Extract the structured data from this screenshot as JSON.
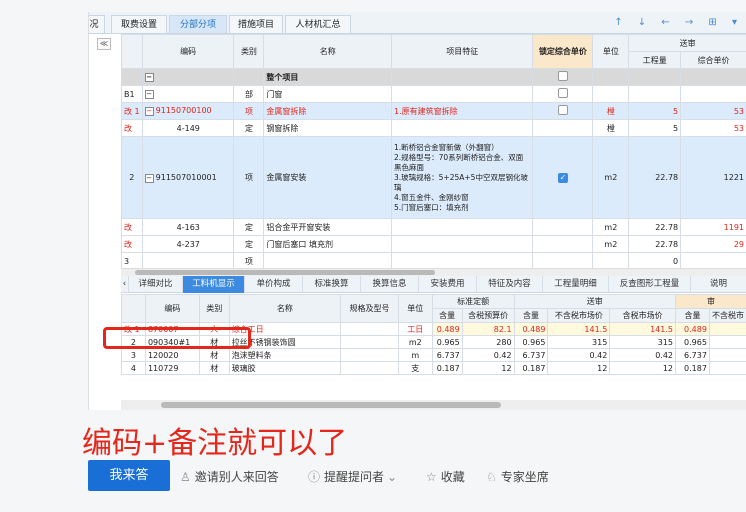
{
  "top_tabs": [
    {
      "label": "况"
    },
    {
      "label": "取费设置"
    },
    {
      "label": "分部分项"
    },
    {
      "label": "措施项目"
    },
    {
      "label": "人材机汇总"
    }
  ],
  "top_icons": "↑ ↓ ← → ⊞ ▾",
  "collapse_icon": "≪",
  "main_table": {
    "headers": {
      "code": "编码",
      "type": "类别",
      "name": "名称",
      "features": "项目特征",
      "lock": "锁定综合单价",
      "unit": "单位",
      "qty": "工程量",
      "price_group": "送审",
      "price": "综合单价"
    },
    "rows": [
      {
        "idx": "",
        "code": "",
        "type": "",
        "name": "整个项目",
        "features": "",
        "unit": "",
        "qty": "",
        "price": ""
      },
      {
        "idx": "B1",
        "code": "",
        "type": "部",
        "name": "门窗",
        "features": "",
        "unit": "",
        "qty": "",
        "price": ""
      },
      {
        "idx": "改 1",
        "code": "91150700100",
        "type": "项",
        "name": "金属窗拆除",
        "features": "1.原有建筑窗拆除",
        "unit": "樘",
        "qty": "5",
        "price": "53"
      },
      {
        "idx": "改",
        "code": "4-149",
        "type": "定",
        "name": "钢窗拆除",
        "features": "",
        "unit": "樘",
        "qty": "5",
        "price": "53"
      },
      {
        "idx": "2",
        "code": "911507010001",
        "type": "项",
        "name": "金属窗安装",
        "features": "1.断桥铝合金窗新做（外翻窗）\n2.规格型号：70系列断桥铝合金、双面黑色麻面\n3.玻璃规格：5+25A+5中空双层钢化玻璃\n4.窗五金件、金刚纱窗\n5.门窗后塞口：填充剂",
        "unit": "m2",
        "qty": "22.78",
        "price": "1221"
      },
      {
        "idx": "改",
        "code": "4-163",
        "type": "定",
        "name": "铝合金平开窗安装",
        "features": "",
        "unit": "m2",
        "qty": "22.78",
        "price": "1191"
      },
      {
        "idx": "改",
        "code": "4-237",
        "type": "定",
        "name": "门窗后塞口 填充剂",
        "features": "",
        "unit": "m2",
        "qty": "22.78",
        "price": "29"
      },
      {
        "idx": "3",
        "code": "",
        "type": "项",
        "name": "",
        "features": "",
        "unit": "",
        "qty": "0",
        "price": ""
      }
    ]
  },
  "sub_tabs": [
    {
      "label": "详细对比"
    },
    {
      "label": "工料机显示"
    },
    {
      "label": "单价构成"
    },
    {
      "label": "标准换算"
    },
    {
      "label": "换算信息"
    },
    {
      "label": "安装费用"
    },
    {
      "label": "特征及内容"
    },
    {
      "label": "工程量明细"
    },
    {
      "label": "反查图形工程量"
    },
    {
      "label": "说明"
    }
  ],
  "material_table": {
    "headers": {
      "code": "编码",
      "type": "类别",
      "name": "名称",
      "spec": "规格及型号",
      "unit": "单位",
      "std_group": "标准定额",
      "std_qty": "含量",
      "std_price": "含税预算价",
      "review_group": "送审",
      "rev_qty": "含量",
      "rev_notax": "不含税市场价",
      "rev_tax": "含税市场价",
      "right_group": "审",
      "r_qty": "含量",
      "r_notax": "不含税市"
    },
    "rows": [
      {
        "idx": "改 1",
        "code": "870007",
        "type": "人",
        "name": "综合工日",
        "spec": "",
        "unit": "工日",
        "std_qty": "0.489",
        "std_price": "82.1",
        "rev_qty": "0.489",
        "rev_notax": "141.5",
        "rev_tax": "141.5",
        "r_qty": "0.489",
        "r_notax": ""
      },
      {
        "idx": "2",
        "code": "090340#1",
        "type": "材",
        "name": "拉丝不锈钢装饰圆",
        "spec": "",
        "unit": "m2",
        "std_qty": "0.965",
        "std_price": "280",
        "rev_qty": "0.965",
        "rev_notax": "315",
        "rev_tax": "315",
        "r_qty": "0.965",
        "r_notax": ""
      },
      {
        "idx": "3",
        "code": "120020",
        "type": "材",
        "name": "泡沫塑料条",
        "spec": "",
        "unit": "m",
        "std_qty": "6.737",
        "std_price": "0.42",
        "rev_qty": "6.737",
        "rev_notax": "0.42",
        "rev_tax": "0.42",
        "r_qty": "6.737",
        "r_notax": ""
      },
      {
        "idx": "4",
        "code": "110729",
        "type": "材",
        "name": "玻璃胶",
        "spec": "",
        "unit": "支",
        "std_qty": "0.187",
        "std_price": "12",
        "rev_qty": "0.187",
        "rev_notax": "12",
        "rev_tax": "12",
        "r_qty": "0.187",
        "r_notax": ""
      }
    ]
  },
  "answer_text": "编码+备注就可以了",
  "actions": {
    "answer_button": "我来答",
    "invite": "邀请别人来回答",
    "remind": "提醒提问者",
    "favorite": "收藏",
    "expert": "专家坐席"
  },
  "colors": {
    "accent": "#1a6fd6",
    "highlight": "#e5261a",
    "lock_header": "#fbe7c9"
  }
}
